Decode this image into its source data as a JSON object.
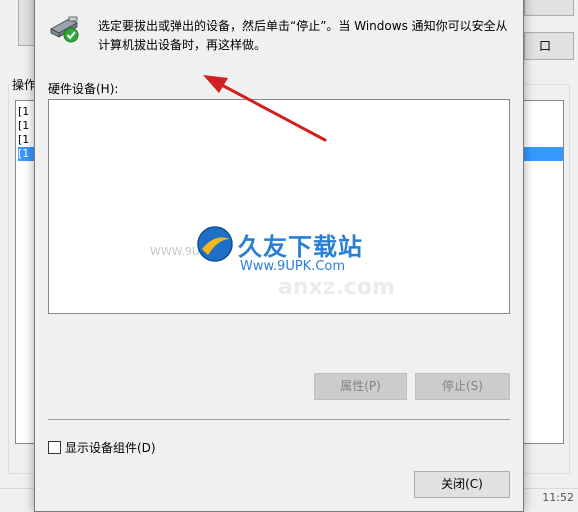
{
  "background": {
    "group_label": "操作",
    "list_rows": [
      "[1",
      "[1",
      "[1",
      "[1"
    ],
    "right_button_label": "口",
    "status_left": "",
    "status_right": "11:52"
  },
  "dialog": {
    "instruction": "选定要拔出或弹出的设备，然后单击“停止”。当 Windows 通知你可以安全从计算机拔出设备时，再这样做。",
    "hardware_label": "硬件设备(H):",
    "properties_button": "属性(P)",
    "stop_button": "停止(S)",
    "show_components_label": "显示设备组件(D)",
    "close_button": "关闭(C)"
  },
  "watermark": {
    "title": "久友下载站",
    "url": "Www.9UPK.Com",
    "small": "WWW.9U",
    "faint": "anxz.com"
  },
  "colors": {
    "accent": "#3399ff",
    "arrow": "#d21f1f",
    "watermark": "#2a7fd2"
  }
}
